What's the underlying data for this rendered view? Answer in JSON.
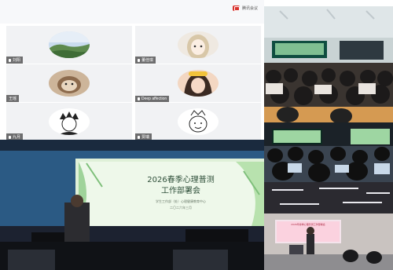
{
  "meeting": {
    "brand_name": "腾讯会议",
    "participants": [
      {
        "name": "刘阳",
        "avatar": "landscape-avatar"
      },
      {
        "name": "董佳琪",
        "avatar": "anime-girl-avatar"
      },
      {
        "name": "王瑶",
        "avatar": "cat-avatar"
      },
      {
        "name": "Deep affection",
        "avatar": "girl-photo-avatar"
      },
      {
        "name": "九月",
        "avatar": "sketch-boy-avatar"
      },
      {
        "name": "贾瑞",
        "avatar": "doodle-face-avatar"
      }
    ]
  },
  "slide": {
    "title_line1": "2026春季心理普测",
    "title_line2": "工作部署会",
    "subtitle": "学生工作部（处）心理健康教育中心",
    "date": "二〇二六年三月"
  },
  "classroom_screen_text": "2026年春季心理普测工作部署会",
  "colors": {
    "slide_green": "#bfe6b0",
    "projector_blue": "#1d5b8f",
    "brand_red": "#d9322d"
  }
}
